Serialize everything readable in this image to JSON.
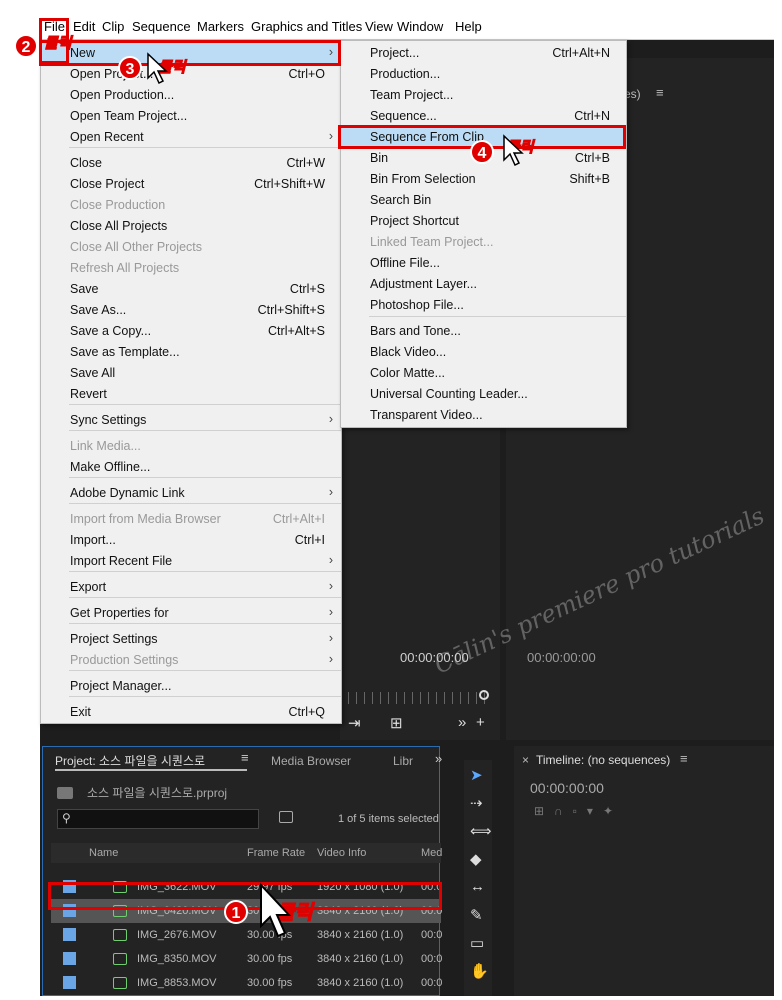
{
  "menubar": [
    "File",
    "Edit",
    "Clip",
    "Sequence",
    "Markers",
    "Graphics and Titles",
    "View",
    "Window",
    "Help"
  ],
  "file_menu": [
    {
      "label": "New",
      "shortcut": "",
      "arrow": true,
      "disabled": false,
      "highlight": true
    },
    {
      "label": "Open Project...",
      "shortcut": "Ctrl+O",
      "arrow": false,
      "disabled": false
    },
    {
      "label": "Open Production...",
      "shortcut": "",
      "arrow": false,
      "disabled": false
    },
    {
      "label": "Open Team Project...",
      "shortcut": "",
      "arrow": false,
      "disabled": false
    },
    {
      "label": "Open Recent",
      "shortcut": "",
      "arrow": true,
      "disabled": false
    },
    {
      "label": "Close",
      "shortcut": "Ctrl+W",
      "arrow": false,
      "disabled": false
    },
    {
      "label": "Close Project",
      "shortcut": "Ctrl+Shift+W",
      "arrow": false,
      "disabled": false
    },
    {
      "label": "Close Production",
      "shortcut": "",
      "arrow": false,
      "disabled": true
    },
    {
      "label": "Close All Projects",
      "shortcut": "",
      "arrow": false,
      "disabled": false
    },
    {
      "label": "Close All Other Projects",
      "shortcut": "",
      "arrow": false,
      "disabled": true
    },
    {
      "label": "Refresh All Projects",
      "shortcut": "",
      "arrow": false,
      "disabled": true
    },
    {
      "label": "Save",
      "shortcut": "Ctrl+S",
      "arrow": false,
      "disabled": false
    },
    {
      "label": "Save As...",
      "shortcut": "Ctrl+Shift+S",
      "arrow": false,
      "disabled": false
    },
    {
      "label": "Save a Copy...",
      "shortcut": "Ctrl+Alt+S",
      "arrow": false,
      "disabled": false
    },
    {
      "label": "Save as Template...",
      "shortcut": "",
      "arrow": false,
      "disabled": false
    },
    {
      "label": "Save All",
      "shortcut": "",
      "arrow": false,
      "disabled": false
    },
    {
      "label": "Revert",
      "shortcut": "",
      "arrow": false,
      "disabled": false
    },
    {
      "label": "Sync Settings",
      "shortcut": "",
      "arrow": true,
      "disabled": false
    },
    {
      "label": "Link Media...",
      "shortcut": "",
      "arrow": false,
      "disabled": true
    },
    {
      "label": "Make Offline...",
      "shortcut": "",
      "arrow": false,
      "disabled": false
    },
    {
      "label": "Adobe Dynamic Link",
      "shortcut": "",
      "arrow": true,
      "disabled": false
    },
    {
      "label": "Import from Media Browser",
      "shortcut": "Ctrl+Alt+I",
      "arrow": false,
      "disabled": true
    },
    {
      "label": "Import...",
      "shortcut": "Ctrl+I",
      "arrow": false,
      "disabled": false
    },
    {
      "label": "Import Recent File",
      "shortcut": "",
      "arrow": true,
      "disabled": false
    },
    {
      "label": "Export",
      "shortcut": "",
      "arrow": true,
      "disabled": false
    },
    {
      "label": "Get Properties for",
      "shortcut": "",
      "arrow": true,
      "disabled": false
    },
    {
      "label": "Project Settings",
      "shortcut": "",
      "arrow": true,
      "disabled": false
    },
    {
      "label": "Production Settings",
      "shortcut": "",
      "arrow": true,
      "disabled": true
    },
    {
      "label": "Project Manager...",
      "shortcut": "",
      "arrow": false,
      "disabled": false
    },
    {
      "label": "Exit",
      "shortcut": "Ctrl+Q",
      "arrow": false,
      "disabled": false
    }
  ],
  "new_submenu": [
    {
      "label": "Project...",
      "shortcut": "Ctrl+Alt+N",
      "disabled": false
    },
    {
      "label": "Production...",
      "shortcut": "",
      "disabled": false
    },
    {
      "label": "Team Project...",
      "shortcut": "",
      "disabled": false
    },
    {
      "label": "Sequence...",
      "shortcut": "Ctrl+N",
      "disabled": false
    },
    {
      "label": "Sequence From Clip",
      "shortcut": "",
      "disabled": false,
      "highlight": true
    },
    {
      "label": "Bin",
      "shortcut": "Ctrl+B",
      "disabled": false
    },
    {
      "label": "Bin From Selection",
      "shortcut": "Shift+B",
      "disabled": false
    },
    {
      "label": "Search Bin",
      "shortcut": "",
      "disabled": false
    },
    {
      "label": "Project Shortcut",
      "shortcut": "",
      "disabled": false
    },
    {
      "label": "Linked Team Project...",
      "shortcut": "",
      "disabled": true
    },
    {
      "label": "Offline File...",
      "shortcut": "",
      "disabled": false
    },
    {
      "label": "Adjustment Layer...",
      "shortcut": "",
      "disabled": false
    },
    {
      "label": "Photoshop File...",
      "shortcut": "",
      "disabled": false
    },
    {
      "label": "Bars and Tone...",
      "shortcut": "",
      "disabled": false
    },
    {
      "label": "Black Video...",
      "shortcut": "",
      "disabled": false
    },
    {
      "label": "Color Matte...",
      "shortcut": "",
      "disabled": false
    },
    {
      "label": "Universal Counting Leader...",
      "shortcut": "",
      "disabled": false
    },
    {
      "label": "Transparent Video...",
      "shortcut": "",
      "disabled": false
    }
  ],
  "monitor": {
    "source_timecode": "00:00:00:00",
    "program_timecode": "00:00:00:00",
    "tab_fragment": "ces)"
  },
  "project": {
    "tab": "Project: 소스 파일을 시퀀스로",
    "media_browser": "Media Browser",
    "libraries": "Libr",
    "file": "소스 파일을 시퀀스로.prproj",
    "items_selected": "1 of 5 items selected",
    "columns": [
      "Name",
      "Frame Rate",
      "Video Info",
      "Med"
    ],
    "rows": [
      {
        "name": "IMG_3622.MOV",
        "fps": "29.97 fps",
        "video": "1920 x 1080 (1.0)",
        "med": "00:0"
      },
      {
        "name": "IMG_0420.MOV",
        "fps": "30.00 fps",
        "video": "3840 x 2160 (1.0)",
        "med": "00:0"
      },
      {
        "name": "IMG_2676.MOV",
        "fps": "30.00 fps",
        "video": "3840 x 2160 (1.0)",
        "med": "00:0"
      },
      {
        "name": "IMG_8350.MOV",
        "fps": "30.00 fps",
        "video": "3840 x 2160 (1.0)",
        "med": "00:0"
      },
      {
        "name": "IMG_8853.MOV",
        "fps": "30.00 fps",
        "video": "3840 x 2160 (1.0)",
        "med": "00:0"
      }
    ]
  },
  "timeline": {
    "tab": "Timeline: (no sequences)",
    "timecode": "00:00:00:00"
  },
  "watermark": "Cālin's premiere pro tutorials",
  "annotations": {
    "click_label": "클릭",
    "steps": [
      "1",
      "2",
      "3",
      "4"
    ]
  },
  "colors": {
    "highlight": "#bcdcf6",
    "annotation": "#e00000",
    "accent": "#2b6cb0"
  }
}
